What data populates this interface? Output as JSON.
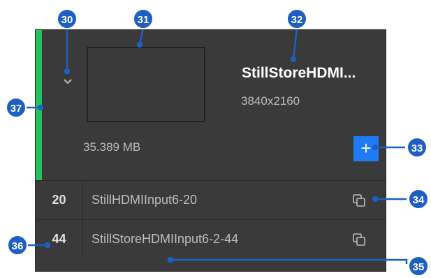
{
  "clip": {
    "name": "StillStoreHDMI...",
    "resolution": "3840x2160",
    "size": "35.389 MB",
    "add_label": "+"
  },
  "rows": [
    {
      "number": "20",
      "name": "StillHDMIInput6-20"
    },
    {
      "number": "44",
      "name": "StillStoreHDMIInput6-2-44"
    }
  ],
  "callouts": [
    "30",
    "31",
    "32",
    "33",
    "34",
    "35",
    "36",
    "37"
  ],
  "colors": {
    "status_bar": "#22c35a",
    "add_button": "#1e7bf5",
    "callout": "#1e5fc4",
    "panel": "#3a3a3a"
  }
}
